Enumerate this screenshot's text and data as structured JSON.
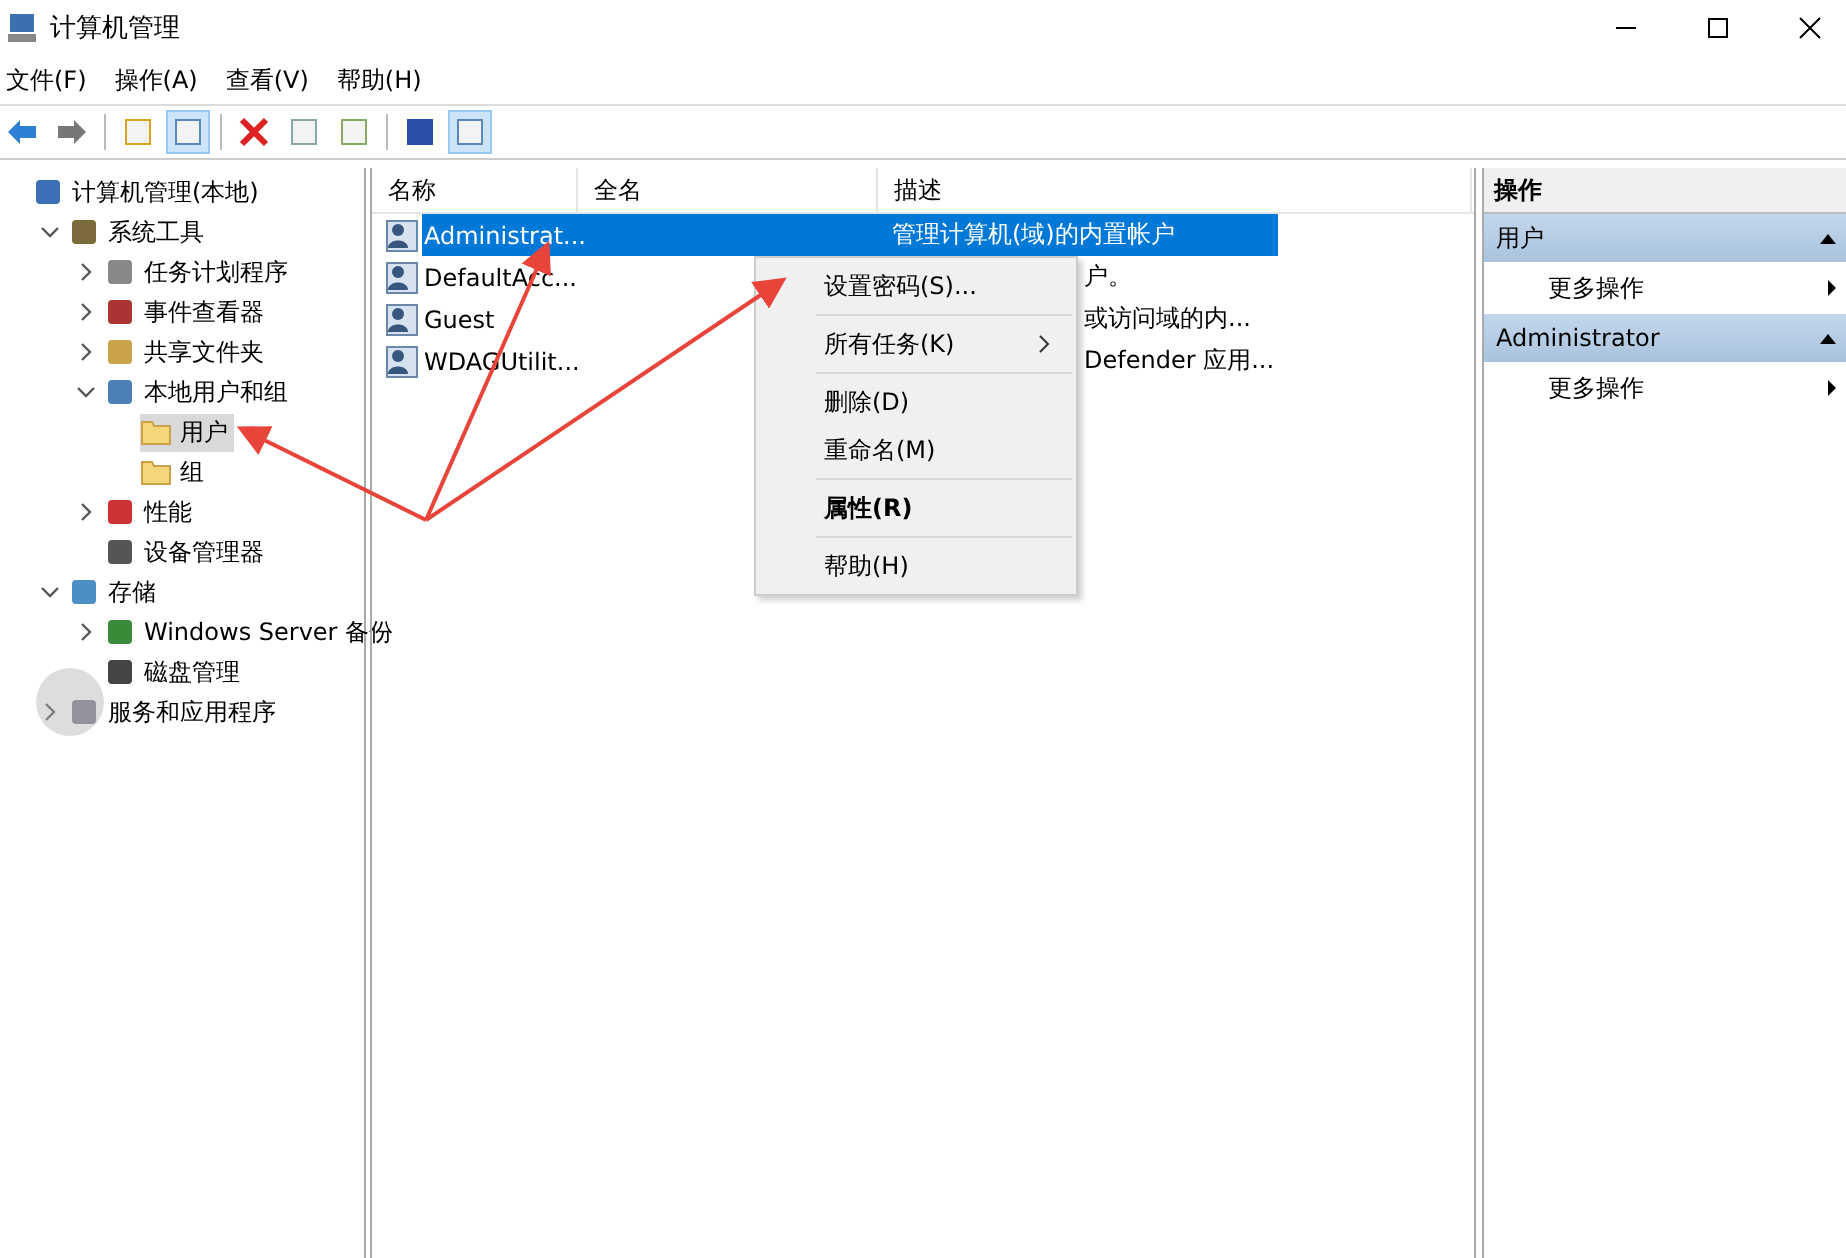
{
  "window": {
    "title": "计算机管理"
  },
  "menu_bar": [
    "文件(F)",
    "操作(A)",
    "查看(V)",
    "帮助(H)"
  ],
  "toolbar": [
    {
      "kind": "button",
      "pressed": false
    },
    {
      "kind": "button",
      "pressed": false
    },
    {
      "kind": "separator"
    },
    {
      "kind": "button",
      "pressed": false
    },
    {
      "kind": "button",
      "pressed": true
    },
    {
      "kind": "separator"
    },
    {
      "kind": "button",
      "pressed": false
    },
    {
      "kind": "button",
      "pressed": false
    },
    {
      "kind": "button",
      "pressed": false
    },
    {
      "kind": "separator"
    },
    {
      "kind": "button",
      "pressed": false
    },
    {
      "kind": "button",
      "pressed": true
    }
  ],
  "tree": [
    {
      "label": "计算机管理(本地)",
      "selected": false,
      "children": [
        {
          "label": "系统工具",
          "expanded": true,
          "selected": false,
          "children": [
            {
              "label": "任务计划程序",
              "expanded": false,
              "selected": false
            },
            {
              "label": "事件查看器",
              "expanded": false,
              "selected": false
            },
            {
              "label": "共享文件夹",
              "expanded": false,
              "selected": false
            },
            {
              "label": "本地用户和组",
              "expanded": true,
              "selected": false,
              "children": [
                {
                  "label": "用户",
                  "selected": true
                },
                {
                  "label": "组",
                  "selected": false
                }
              ]
            },
            {
              "label": "性能",
              "expanded": false,
              "selected": false
            },
            {
              "label": "设备管理器",
              "selected": false
            }
          ]
        },
        {
          "label": "存储",
          "expanded": true,
          "selected": false,
          "children": [
            {
              "label": "Windows Server 备份",
              "expanded": false,
              "selected": false
            },
            {
              "label": "磁盘管理",
              "selected": false
            }
          ]
        },
        {
          "label": "服务和应用程序",
          "expanded": false,
          "selected": false
        }
      ]
    }
  ],
  "table": {
    "columns": [
      "名称",
      "全名",
      "描述"
    ],
    "rows": [
      {
        "name": "Administrat...",
        "description": "管理计算机(域)的内置帐户",
        "selected": true
      },
      {
        "name": "DefaultAcc...",
        "description": "户。",
        "selected": false
      },
      {
        "name": "Guest",
        "description": "或访问域的内...",
        "selected": false
      },
      {
        "name": "WDAGUtilit...",
        "description": "Defender 应用...",
        "selected": false
      }
    ]
  },
  "context_menu": [
    {
      "kind": "item",
      "label": "设置密码(S)...",
      "bold": false,
      "submenu": false
    },
    {
      "kind": "separator"
    },
    {
      "kind": "item",
      "label": "所有任务(K)",
      "bold": false,
      "submenu": true
    },
    {
      "kind": "separator"
    },
    {
      "kind": "item",
      "label": "删除(D)",
      "bold": false,
      "submenu": false
    },
    {
      "kind": "item",
      "label": "重命名(M)",
      "bold": false,
      "submenu": false
    },
    {
      "kind": "separator"
    },
    {
      "kind": "item",
      "label": "属性(R)",
      "bold": true,
      "submenu": false
    },
    {
      "kind": "separator"
    },
    {
      "kind": "item",
      "label": "帮助(H)",
      "bold": false,
      "submenu": false
    }
  ],
  "actions": {
    "title": "操作",
    "sections": [
      {
        "title": "用户",
        "items": [
          "更多操作"
        ]
      },
      {
        "title": "Administrator",
        "items": [
          "更多操作"
        ]
      }
    ]
  }
}
